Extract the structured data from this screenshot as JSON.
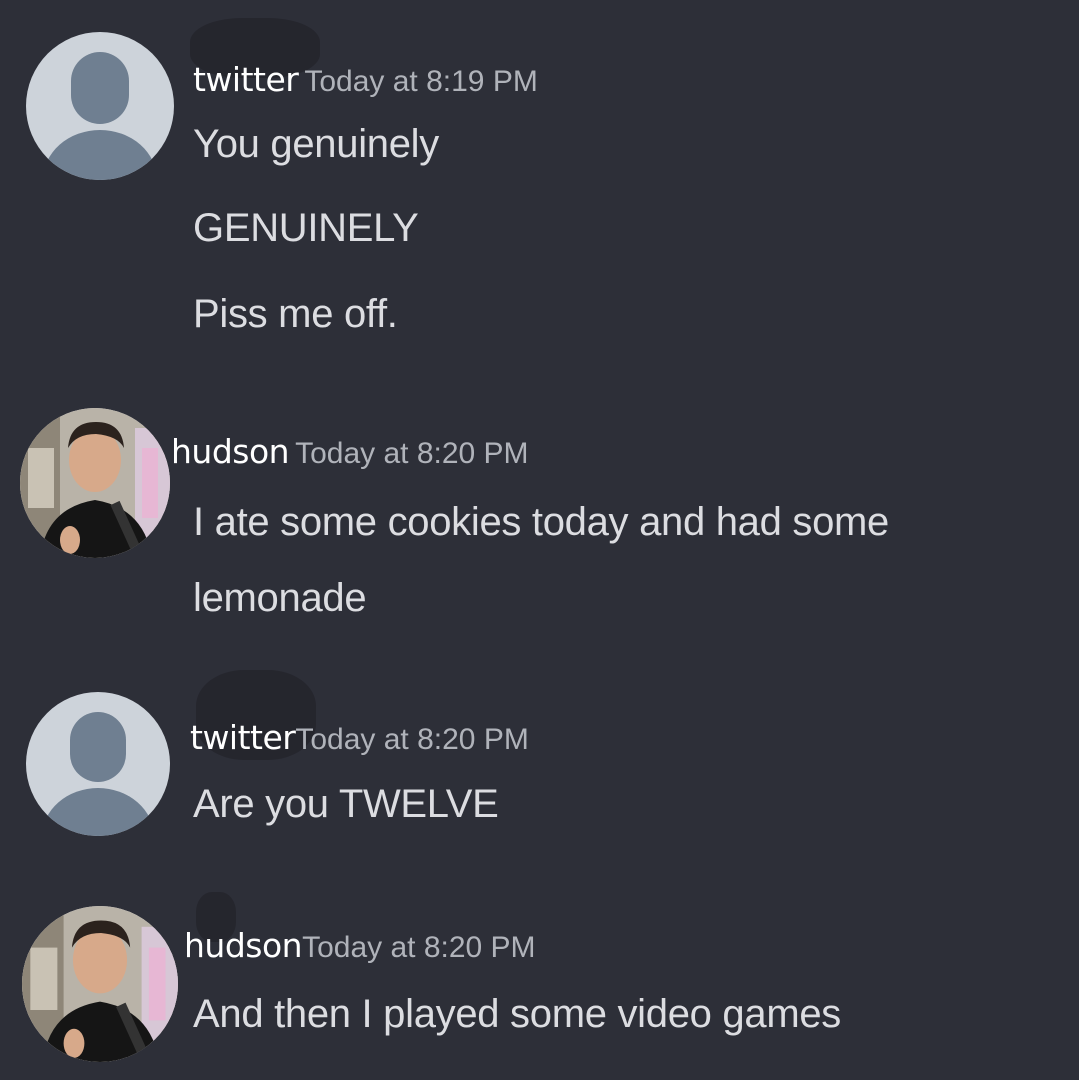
{
  "messages": [
    {
      "username": "twitter",
      "timestamp": "Today at 8:19 PM",
      "lines": [
        "You genuinely",
        "GENUINELY",
        "Piss me off."
      ],
      "avatar": "default-avatar"
    },
    {
      "username": "hudson",
      "timestamp": "Today at 8:20 PM",
      "lines": [
        "I ate some cookies today and had some",
        "lemonade"
      ],
      "avatar": "profile-photo"
    },
    {
      "username": "twitter",
      "timestamp": "Today at 8:20 PM",
      "lines": [
        "Are you TWELVE"
      ],
      "avatar": "default-avatar"
    },
    {
      "username": "hudson",
      "timestamp": "Today at 8:20 PM",
      "lines": [
        "And then I played some video games"
      ],
      "avatar": "profile-photo"
    }
  ],
  "colors": {
    "background": "#2d2f38",
    "username": "#ffffff",
    "timestamp": "#b0b3ba",
    "message_text": "#dcdde1",
    "default_avatar_bg": "#cdd3da",
    "default_avatar_figure": "#6f7f91"
  }
}
